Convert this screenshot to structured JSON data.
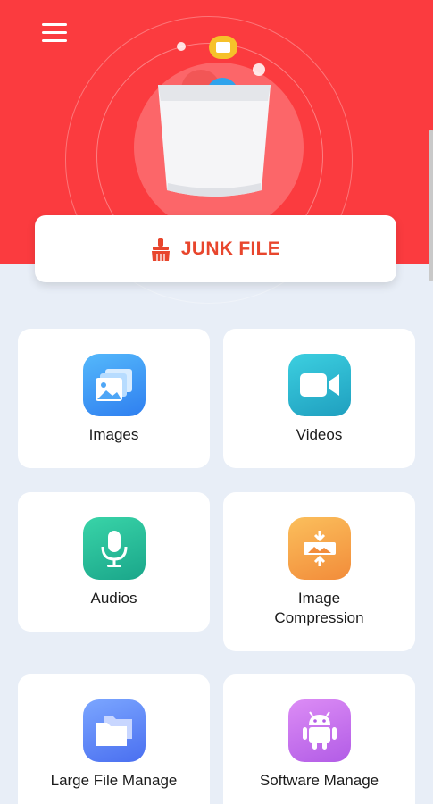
{
  "header": {
    "menu_icon": "hamburger-menu-icon",
    "hero_icon": "trash-bin-icon",
    "background_color": "#fb3b3f"
  },
  "junk": {
    "label": "JUNK FILE",
    "icon": "broom-icon",
    "color": "#e8462d"
  },
  "categories": [
    {
      "label": "Images",
      "icon": "images-icon"
    },
    {
      "label": "Videos",
      "icon": "video-camera-icon"
    },
    {
      "label": "Audios",
      "icon": "microphone-icon"
    },
    {
      "label": "Image\nCompression",
      "icon": "image-compression-icon"
    },
    {
      "label": "Large File Manage",
      "icon": "folders-icon"
    },
    {
      "label": "Software Manage",
      "icon": "android-icon"
    }
  ]
}
